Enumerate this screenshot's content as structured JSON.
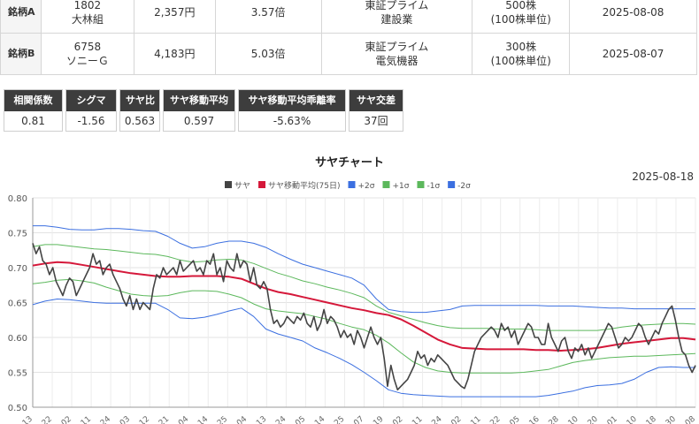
{
  "pair_table": {
    "rows": [
      {
        "label": "銘柄A",
        "code": "1802",
        "name": "大林組",
        "price": "2,357円",
        "ratio": "3.57倍",
        "market": "東証プライム",
        "sector": "建設業",
        "lot": "500株",
        "lot_unit": "(100株単位)",
        "date": "2025-08-08"
      },
      {
        "label": "銘柄B",
        "code": "6758",
        "name": "ソニーＧ",
        "price": "4,183円",
        "ratio": "5.03倍",
        "market": "東証プライム",
        "sector": "電気機器",
        "lot": "300株",
        "lot_unit": "(100株単位)",
        "date": "2025-08-07"
      }
    ]
  },
  "stats": [
    {
      "label": "相関係数",
      "value": "0.81"
    },
    {
      "label": "シグマ",
      "value": "-1.56"
    },
    {
      "label": "サヤ比",
      "value": "0.563"
    },
    {
      "label": "サヤ移動平均",
      "value": "0.597"
    },
    {
      "label": "サヤ移動平均乖離率",
      "value": "-5.63%"
    },
    {
      "label": "サヤ交差",
      "value": "37回"
    }
  ],
  "chart": {
    "title": "サヤチャート",
    "date": "2025-08-18"
  },
  "chart_data": {
    "type": "line",
    "ylim": [
      0.5,
      0.8
    ],
    "y_ticks": [
      "0.50",
      "0.55",
      "0.60",
      "0.65",
      "0.70",
      "0.75",
      "0.80"
    ],
    "grid": true,
    "legend_position": "top-center",
    "x_tick_labels": [
      "13",
      "22",
      "02",
      "11",
      "24",
      "03",
      "12",
      "21",
      "04",
      "14",
      "25",
      "04",
      "13",
      "24",
      "05",
      "14",
      "25",
      "07",
      "19",
      "02",
      "11",
      "24",
      "02",
      "11",
      "22",
      "05",
      "16",
      "28",
      "10",
      "20",
      "01",
      "10",
      "18",
      "30",
      "08"
    ],
    "series": [
      {
        "name": "サヤ",
        "color": "#444444",
        "values": [
          0.735,
          0.72,
          0.73,
          0.71,
          0.705,
          0.69,
          0.7,
          0.68,
          0.67,
          0.66,
          0.675,
          0.685,
          0.68,
          0.66,
          0.67,
          0.68,
          0.69,
          0.7,
          0.72,
          0.705,
          0.71,
          0.69,
          0.7,
          0.705,
          0.69,
          0.68,
          0.67,
          0.655,
          0.645,
          0.66,
          0.64,
          0.655,
          0.64,
          0.65,
          0.645,
          0.64,
          0.67,
          0.69,
          0.685,
          0.7,
          0.69,
          0.695,
          0.7,
          0.69,
          0.71,
          0.695,
          0.7,
          0.705,
          0.71,
          0.695,
          0.7,
          0.69,
          0.71,
          0.705,
          0.72,
          0.69,
          0.7,
          0.68,
          0.71,
          0.7,
          0.695,
          0.72,
          0.7,
          0.71,
          0.705,
          0.68,
          0.7,
          0.675,
          0.67,
          0.68,
          0.67,
          0.64,
          0.62,
          0.625,
          0.615,
          0.62,
          0.63,
          0.625,
          0.62,
          0.63,
          0.625,
          0.635,
          0.62,
          0.615,
          0.63,
          0.61,
          0.62,
          0.64,
          0.62,
          0.63,
          0.625,
          0.615,
          0.6,
          0.61,
          0.6,
          0.605,
          0.59,
          0.61,
          0.6,
          0.585,
          0.6,
          0.615,
          0.6,
          0.59,
          0.6,
          0.57,
          0.53,
          0.56,
          0.54,
          0.525,
          0.53,
          0.535,
          0.54,
          0.55,
          0.56,
          0.58,
          0.57,
          0.575,
          0.56,
          0.57,
          0.565,
          0.575,
          0.57,
          0.565,
          0.56,
          0.55,
          0.54,
          0.535,
          0.53,
          0.527,
          0.54,
          0.56,
          0.58,
          0.59,
          0.6,
          0.605,
          0.61,
          0.615,
          0.61,
          0.6,
          0.62,
          0.61,
          0.615,
          0.6,
          0.61,
          0.59,
          0.6,
          0.61,
          0.62,
          0.615,
          0.6,
          0.6,
          0.59,
          0.59,
          0.62,
          0.6,
          0.59,
          0.58,
          0.595,
          0.6,
          0.58,
          0.57,
          0.585,
          0.58,
          0.59,
          0.575,
          0.585,
          0.57,
          0.58,
          0.59,
          0.6,
          0.61,
          0.62,
          0.615,
          0.6,
          0.585,
          0.59,
          0.6,
          0.595,
          0.6,
          0.61,
          0.62,
          0.615,
          0.6,
          0.59,
          0.6,
          0.61,
          0.605,
          0.62,
          0.63,
          0.64,
          0.645,
          0.625,
          0.6,
          0.58,
          0.575,
          0.56,
          0.55,
          0.56
        ]
      },
      {
        "name": "サヤ移動平均(75日)",
        "color": "#d5183a",
        "values": [
          0.703,
          0.706,
          0.708,
          0.707,
          0.704,
          0.701,
          0.698,
          0.695,
          0.692,
          0.69,
          0.688,
          0.687,
          0.687,
          0.688,
          0.688,
          0.688,
          0.687,
          0.684,
          0.677,
          0.67,
          0.665,
          0.662,
          0.658,
          0.654,
          0.65,
          0.646,
          0.642,
          0.639,
          0.635,
          0.632,
          0.626,
          0.617,
          0.607,
          0.597,
          0.59,
          0.585,
          0.584,
          0.583,
          0.583,
          0.583,
          0.583,
          0.582,
          0.582,
          0.581,
          0.582,
          0.583,
          0.585,
          0.588,
          0.591,
          0.593,
          0.595,
          0.597,
          0.599,
          0.599,
          0.597
        ]
      },
      {
        "name": "+2σ",
        "color": "#3b6fe0",
        "values": [
          0.76,
          0.76,
          0.758,
          0.755,
          0.754,
          0.754,
          0.756,
          0.756,
          0.755,
          0.753,
          0.752,
          0.745,
          0.735,
          0.728,
          0.73,
          0.735,
          0.738,
          0.738,
          0.735,
          0.729,
          0.72,
          0.712,
          0.705,
          0.7,
          0.695,
          0.69,
          0.685,
          0.675,
          0.655,
          0.64,
          0.637,
          0.636,
          0.636,
          0.638,
          0.64,
          0.645,
          0.646,
          0.646,
          0.646,
          0.646,
          0.646,
          0.646,
          0.645,
          0.645,
          0.645,
          0.644,
          0.643,
          0.642,
          0.642,
          0.641,
          0.641,
          0.641,
          0.641,
          0.641,
          0.641
        ]
      },
      {
        "name": "+1σ",
        "color": "#5cb85c",
        "values": [
          0.73,
          0.733,
          0.733,
          0.731,
          0.729,
          0.727,
          0.726,
          0.724,
          0.722,
          0.72,
          0.719,
          0.716,
          0.711,
          0.708,
          0.709,
          0.711,
          0.712,
          0.711,
          0.706,
          0.699,
          0.692,
          0.687,
          0.681,
          0.677,
          0.672,
          0.668,
          0.663,
          0.657,
          0.645,
          0.636,
          0.631,
          0.626,
          0.621,
          0.617,
          0.614,
          0.613,
          0.613,
          0.613,
          0.612,
          0.612,
          0.612,
          0.611,
          0.61,
          0.61,
          0.61,
          0.61,
          0.61,
          0.612,
          0.615,
          0.617,
          0.618,
          0.619,
          0.62,
          0.62,
          0.619
        ]
      },
      {
        "name": "-1σ",
        "color": "#5cb85c",
        "values": [
          0.677,
          0.679,
          0.682,
          0.683,
          0.681,
          0.678,
          0.672,
          0.667,
          0.662,
          0.66,
          0.659,
          0.66,
          0.664,
          0.667,
          0.667,
          0.666,
          0.662,
          0.657,
          0.648,
          0.641,
          0.638,
          0.636,
          0.634,
          0.63,
          0.626,
          0.62,
          0.615,
          0.611,
          0.603,
          0.592,
          0.578,
          0.565,
          0.557,
          0.552,
          0.55,
          0.549,
          0.549,
          0.549,
          0.549,
          0.549,
          0.55,
          0.552,
          0.554,
          0.559,
          0.564,
          0.567,
          0.569,
          0.571,
          0.572,
          0.573,
          0.573,
          0.574,
          0.575,
          0.576,
          0.577
        ]
      },
      {
        "name": "-2σ",
        "color": "#3b6fe0",
        "values": [
          0.647,
          0.652,
          0.655,
          0.654,
          0.652,
          0.65,
          0.649,
          0.649,
          0.649,
          0.649,
          0.649,
          0.64,
          0.628,
          0.627,
          0.629,
          0.633,
          0.638,
          0.642,
          0.63,
          0.612,
          0.605,
          0.6,
          0.595,
          0.585,
          0.578,
          0.57,
          0.561,
          0.55,
          0.538,
          0.525,
          0.52,
          0.518,
          0.517,
          0.516,
          0.515,
          0.515,
          0.515,
          0.515,
          0.515,
          0.515,
          0.515,
          0.515,
          0.517,
          0.52,
          0.523,
          0.528,
          0.531,
          0.532,
          0.534,
          0.54,
          0.55,
          0.557,
          0.558,
          0.557,
          0.557
        ]
      }
    ]
  }
}
